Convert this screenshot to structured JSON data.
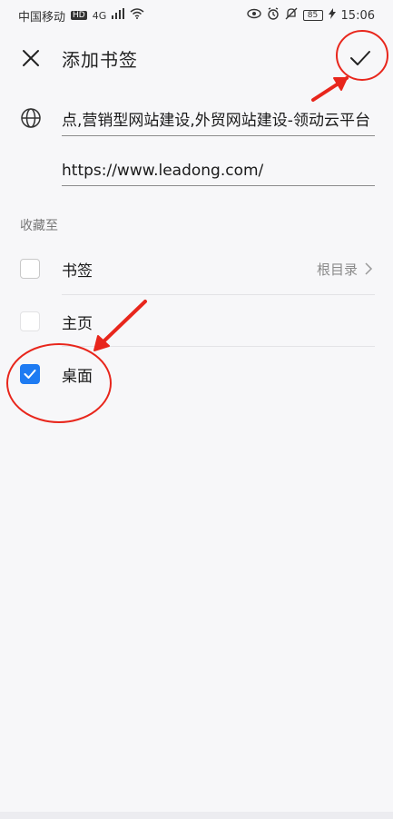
{
  "status_bar": {
    "carrier": "中国移动",
    "hd_badge": "HD",
    "net": "4G",
    "battery": "85",
    "time": "15:06"
  },
  "header": {
    "title": "添加书签"
  },
  "form": {
    "title_value": "点,营销型网站建设,外贸网站建设-领动云平台",
    "url_value": "https://www.leadong.com/"
  },
  "save_to": {
    "label": "收藏至",
    "options": [
      {
        "label": "书签",
        "right_text": "根目录",
        "checked": false
      },
      {
        "label": "主页",
        "checked": false
      },
      {
        "label": "桌面",
        "checked": true
      }
    ]
  },
  "colors": {
    "accent": "#1e7bf2",
    "annotation": "#e8261c"
  }
}
